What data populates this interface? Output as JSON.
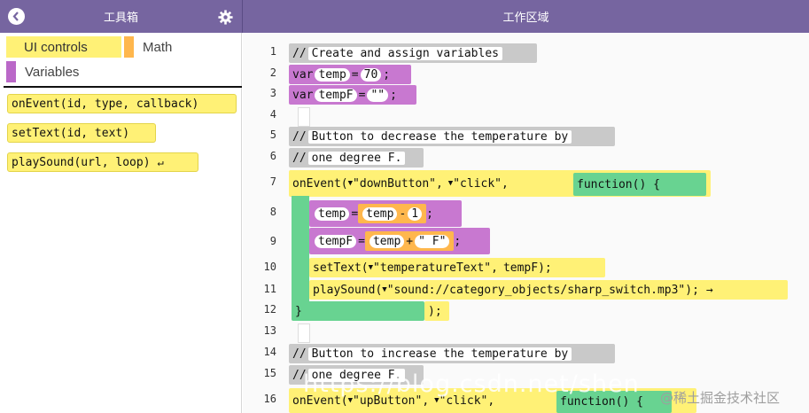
{
  "header": {
    "toolbox_title": "工具箱",
    "workspace_title": "工作区域"
  },
  "toolbox": {
    "categories": [
      {
        "label": "UI controls",
        "color": "#fff176"
      },
      {
        "label": "Math",
        "color": "#ffb74d"
      },
      {
        "label": "Variables",
        "color": "#ba68c8"
      }
    ],
    "blocks": [
      {
        "label": "onEvent(id, type, callback)"
      },
      {
        "label": "setText(id, text)"
      },
      {
        "label": "playSound(url, loop)"
      }
    ]
  },
  "workspace": {
    "line_numbers": [
      "1",
      "2",
      "3",
      "4",
      "5",
      "6",
      "7",
      "8",
      "9",
      "10",
      "11",
      "12",
      "13",
      "14",
      "15",
      "16"
    ],
    "code": {
      "l1_comment": "Create and assign variables",
      "l2_var": "var",
      "l2_name": "temp",
      "l2_eq": "=",
      "l2_val": "70",
      "l3_var": "var",
      "l3_name": "tempF",
      "l3_eq": "=",
      "l3_val": "\"\"",
      "l5_comment": "Button to decrease the temperature by",
      "l6_comment": "one degree F.",
      "l7_fn": "onEvent(",
      "l7_id": "\"downButton\",",
      "l7_type": "\"click\",",
      "l7_callback": "function() {",
      "l8_name": "temp",
      "l8_eq": "=",
      "l8_a": "temp",
      "l8_op": "-",
      "l8_b": "1",
      "l9_name": "tempF",
      "l9_eq": "=",
      "l9_a": "temp",
      "l9_op": "+",
      "l9_b": "\" F\"",
      "l10_fn": "setText(",
      "l10_id": "\"temperatureText\",",
      "l10_text": "tempF);",
      "l11_fn": "playSound(",
      "l11_url": "\"sound://category_objects/sharp_switch.mp3\");",
      "l12_close": "}",
      "l12_paren": ");",
      "l14_comment": "Button to increase the temperature by",
      "l15_comment": "one degree F.",
      "l16_fn": "onEvent(",
      "l16_id": "\"upButton\",",
      "l16_type": "\"click\",",
      "l16_callback": "function() {"
    }
  },
  "watermarks": {
    "url_text": "https://blog.csdn.net/shen",
    "site_text": "@稀土掘金技术社区"
  }
}
